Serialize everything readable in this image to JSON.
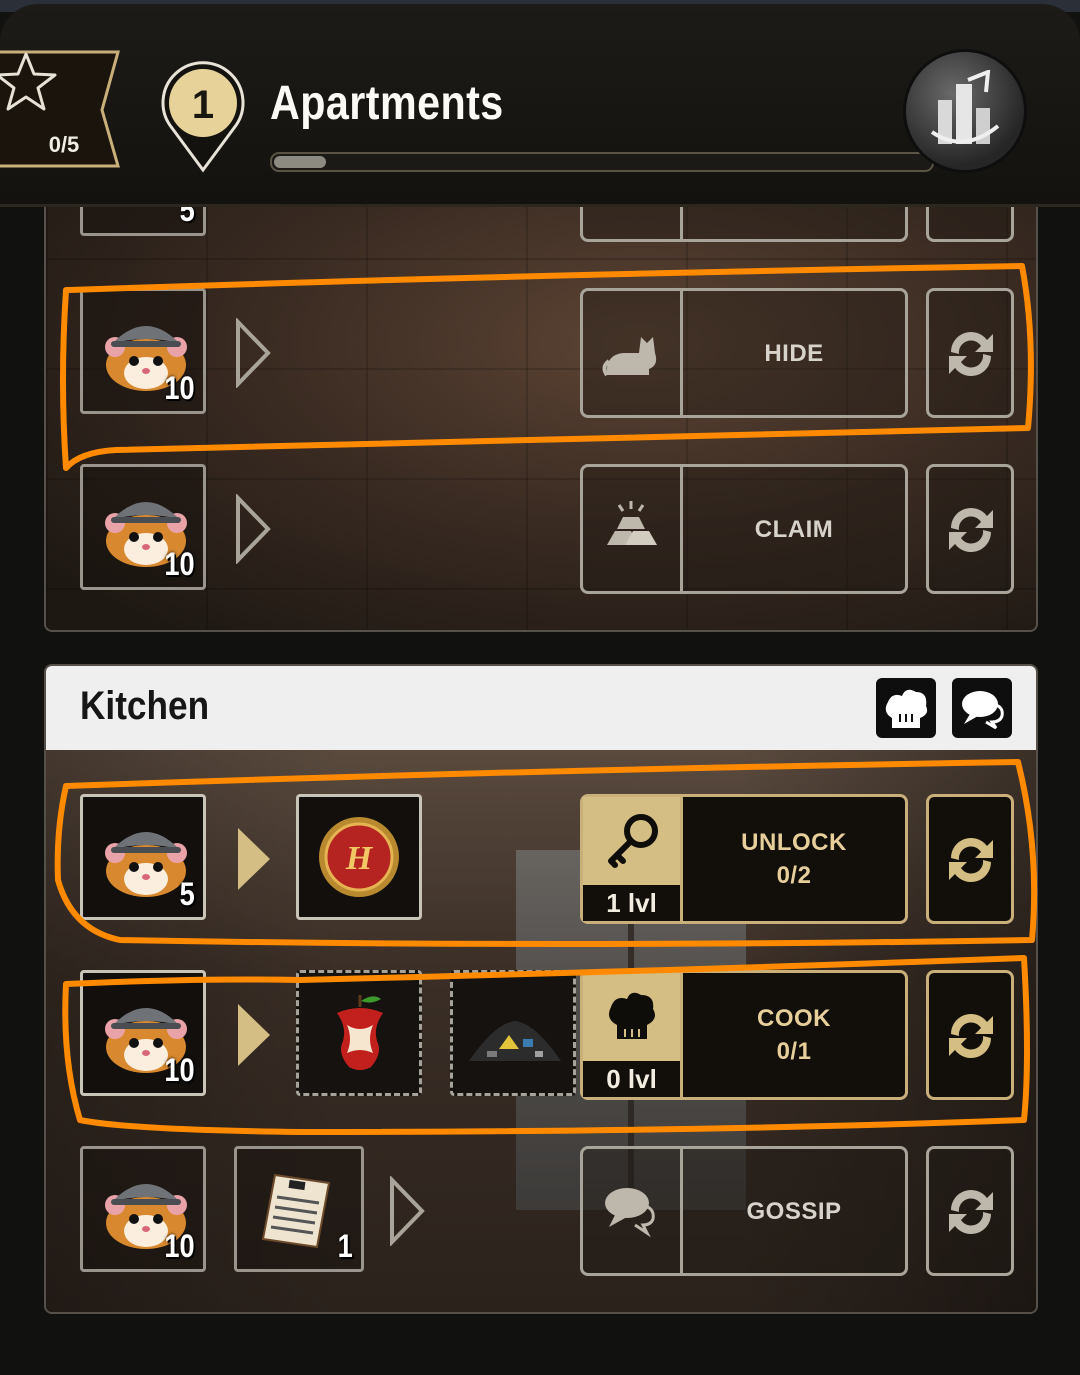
{
  "header": {
    "stars": "0/5",
    "level": "1",
    "title": "Apartments",
    "progress": 0.08
  },
  "apartments": {
    "top_partial_count": "5",
    "rows": [
      {
        "count": "10",
        "action": "HIDE",
        "action_icon": "cat-icon"
      },
      {
        "count": "10",
        "action": "CLAIM",
        "action_icon": "gold-bars-icon"
      }
    ]
  },
  "kitchen": {
    "title": "Kitchen",
    "rows": [
      {
        "count": "5",
        "action": "UNLOCK",
        "progress": "0/2",
        "level": "1 lvl",
        "action_icon": "key-icon",
        "reward": "coin-icon"
      },
      {
        "count": "10",
        "action": "COOK",
        "progress": "0/1",
        "level": "0 lvl",
        "action_icon": "chef-hat-icon",
        "inputs": [
          "apple-core-icon",
          "trash-pile-icon"
        ]
      },
      {
        "count": "10",
        "item_count": "1",
        "action": "GOSSIP",
        "action_icon": "speech-bubbles-icon",
        "item": "newspaper-icon"
      }
    ]
  },
  "colors": {
    "gold": "#d4be84",
    "highlight": "#ff8a00"
  }
}
